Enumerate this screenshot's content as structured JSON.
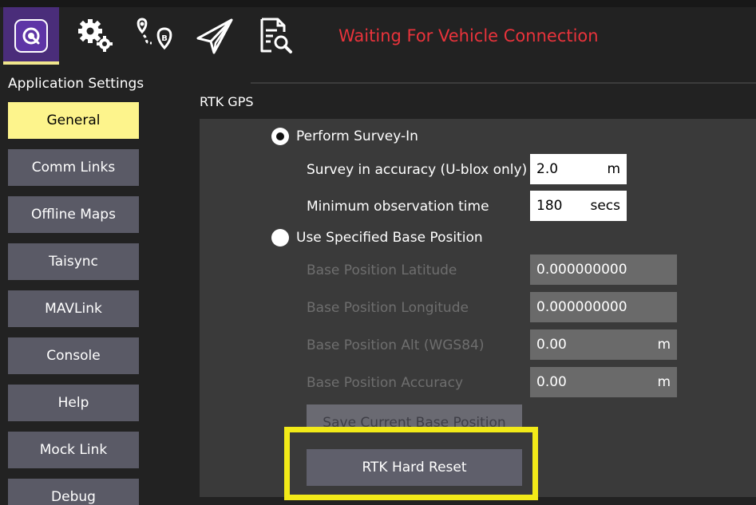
{
  "toolbar": {
    "icons": [
      "app-logo-icon",
      "gear-icon",
      "route-waypoint-icon",
      "paper-plane-icon",
      "document-search-icon"
    ],
    "status": "Waiting For Vehicle Connection",
    "status_color": "#e8333b",
    "active_underline_color": "#f0e68c"
  },
  "sidebar": {
    "title": "Application Settings",
    "items": [
      {
        "label": "General",
        "active": true
      },
      {
        "label": "Comm Links",
        "active": false
      },
      {
        "label": "Offline Maps",
        "active": false
      },
      {
        "label": "Taisync",
        "active": false
      },
      {
        "label": "MAVLink",
        "active": false
      },
      {
        "label": "Console",
        "active": false
      },
      {
        "label": "Help",
        "active": false
      },
      {
        "label": "Mock Link",
        "active": false
      },
      {
        "label": "Debug",
        "active": false
      }
    ],
    "active_color": "#fdf48c"
  },
  "rtk": {
    "section_title": "RTK GPS",
    "survey_in": {
      "label": "Perform Survey-In",
      "selected": true,
      "accuracy_label": "Survey in accuracy (U-blox only)",
      "accuracy_value": "2.0",
      "accuracy_unit": "m",
      "min_obs_label": "Minimum observation time",
      "min_obs_value": "180",
      "min_obs_unit": "secs"
    },
    "specified": {
      "label": "Use Specified Base Position",
      "selected": false,
      "lat_label": "Base Position Latitude",
      "lat_value": "0.000000000",
      "lon_label": "Base Position Longitude",
      "lon_value": "0.000000000",
      "alt_label": "Base Position Alt (WGS84)",
      "alt_value": "0.00",
      "alt_unit": "m",
      "acc_label": "Base Position Accuracy",
      "acc_value": "0.00",
      "acc_unit": "m"
    },
    "save_button": "Save Current Base Position",
    "reset_button": "RTK Hard Reset",
    "highlight_color": "#f2ea18"
  }
}
